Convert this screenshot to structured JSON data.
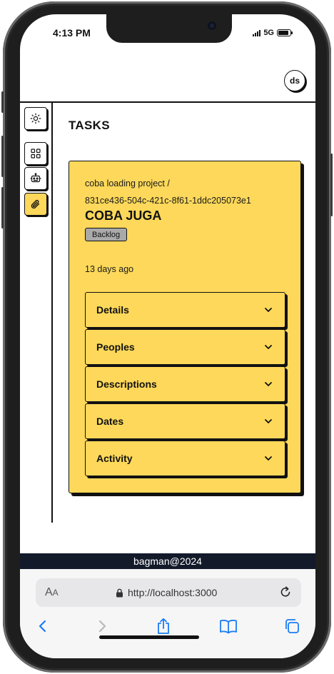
{
  "status_bar": {
    "time": "4:13 PM",
    "network": "5G",
    "battery_level": 0.9
  },
  "header": {
    "avatar_initials": "ds"
  },
  "sidebar": {
    "items": [
      {
        "icon": "sun-icon"
      },
      {
        "icon": "dashboard-grid-icon"
      },
      {
        "icon": "robot-icon"
      },
      {
        "icon": "paperclip-icon",
        "active": true
      }
    ]
  },
  "page": {
    "title": "TASKS"
  },
  "task": {
    "project": "coba loading project",
    "separator": "/",
    "id": "831ce436-504c-421c-8f61-1ddc205073e1",
    "title": "COBA JUGA",
    "status": "Backlog",
    "updated": "13 days ago",
    "sections": [
      {
        "label": "Details"
      },
      {
        "label": "Peoples"
      },
      {
        "label": "Descriptions"
      },
      {
        "label": "Dates"
      },
      {
        "label": "Activity"
      }
    ]
  },
  "footer": {
    "text": "bagman@2024"
  },
  "browser": {
    "text_size_label": "A",
    "text_size_small": "A",
    "url": "http://localhost:3000"
  },
  "colors": {
    "accent": "#fdd85a",
    "footer_bg": "#131a2a",
    "badge": "#a9a9a9",
    "ios_blue": "#1a7cf5"
  }
}
